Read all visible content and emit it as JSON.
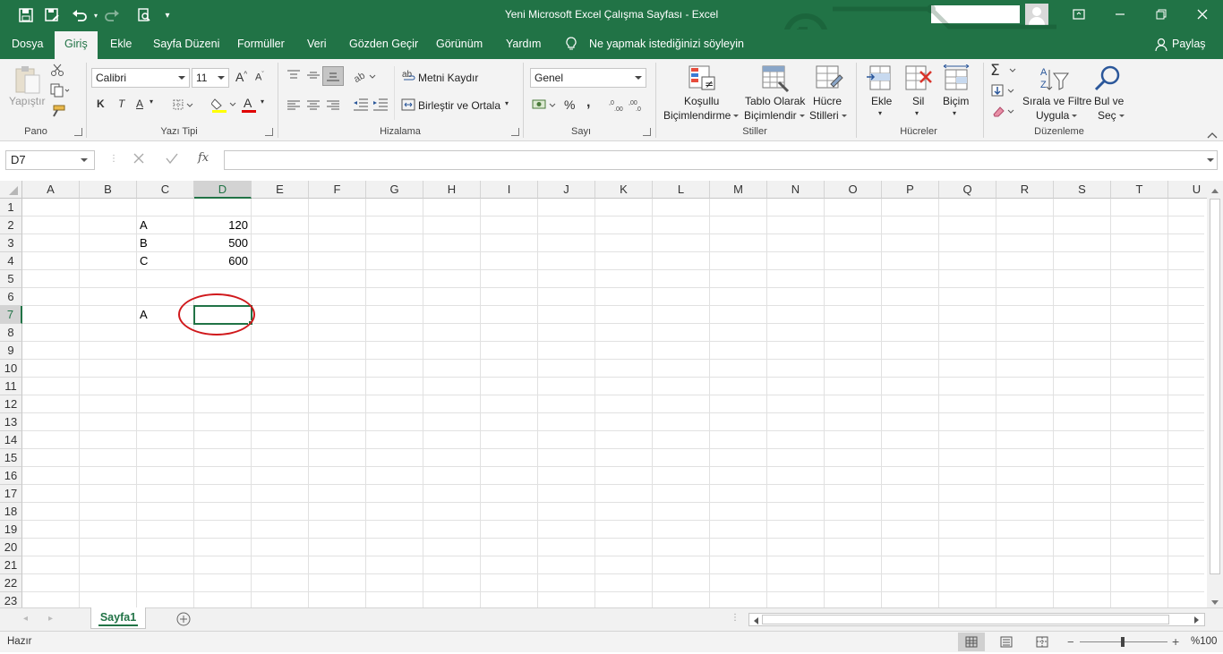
{
  "window": {
    "title": "Yeni Microsoft Excel Çalışma Sayfası  -  Excel"
  },
  "tabs": [
    "Dosya",
    "Giriş",
    "Ekle",
    "Sayfa Düzeni",
    "Formüller",
    "Veri",
    "Gözden Geçir",
    "Görünüm",
    "Yardım"
  ],
  "active_tab": "Giriş",
  "tell_me": "Ne yapmak istediğinizi söyleyin",
  "share": "Paylaş",
  "ribbon": {
    "clipboard": {
      "label": "Pano",
      "paste": "Yapıştır"
    },
    "font": {
      "label": "Yazı Tipi",
      "name": "Calibri",
      "size": "11",
      "bold": "K",
      "italic": "T",
      "underline": "A",
      "font_color_glyph": "A"
    },
    "alignment": {
      "label": "Hizalama",
      "wrap": "Metni Kaydır",
      "merge": "Birleştir ve Ortala"
    },
    "number": {
      "label": "Sayı",
      "format": "Genel",
      "percent": "%",
      "comma": ","
    },
    "styles": {
      "label": "Stiller",
      "conditional_1": "Koşullu",
      "conditional_2": "Biçimlendirme",
      "table_1": "Tablo Olarak",
      "table_2": "Biçimlendir",
      "cell_1": "Hücre",
      "cell_2": "Stilleri"
    },
    "cells": {
      "label": "Hücreler",
      "insert": "Ekle",
      "delete": "Sil",
      "format": "Biçim"
    },
    "editing": {
      "label": "Düzenleme",
      "sort_1": "Sırala ve Filtre",
      "sort_2": "Uygula",
      "find_1": "Bul ve",
      "find_2": "Seç"
    }
  },
  "formula_bar": {
    "name_box": "D7",
    "fx": "fx",
    "content": ""
  },
  "columns": [
    "A",
    "B",
    "C",
    "D",
    "E",
    "F",
    "G",
    "H",
    "I",
    "J",
    "K",
    "L",
    "M",
    "N",
    "O",
    "P",
    "Q",
    "R",
    "S",
    "T",
    "U"
  ],
  "rows": [
    "1",
    "2",
    "3",
    "4",
    "5",
    "6",
    "7",
    "8",
    "9",
    "10",
    "11",
    "12",
    "13",
    "14",
    "15",
    "16",
    "17",
    "18",
    "19",
    "20",
    "21",
    "22",
    "23"
  ],
  "cells": {
    "C2": "A",
    "D2": "120",
    "C3": "B",
    "D3": "500",
    "C4": "C",
    "D4": "600",
    "C7": "A"
  },
  "selected_cell": "D7",
  "sheet": {
    "name": "Sayfa1"
  },
  "status": {
    "ready": "Hazır",
    "zoom": "%100"
  },
  "colors": {
    "excel_green": "#217346",
    "annotation_red": "#d0191c"
  }
}
